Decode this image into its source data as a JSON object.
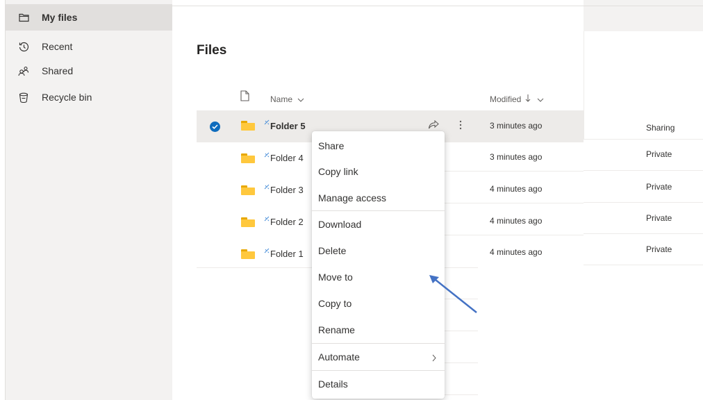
{
  "sidebar": {
    "items": [
      {
        "label": "My files",
        "icon": "folder-icon"
      },
      {
        "label": "Recent",
        "icon": "history-icon"
      },
      {
        "label": "Shared",
        "icon": "people-icon"
      },
      {
        "label": "Recycle bin",
        "icon": "trash-icon"
      }
    ]
  },
  "main": {
    "title": "Files",
    "columns": {
      "name": "Name",
      "modified": "Modified"
    },
    "rows": [
      {
        "name": "Folder 5",
        "modified": "3 minutes ago",
        "sharing": "Sharing",
        "selected": true
      },
      {
        "name": "Folder 4",
        "modified": "3 minutes ago",
        "sharing": "Private"
      },
      {
        "name": "Folder 3",
        "modified": "4 minutes ago",
        "sharing": "Private"
      },
      {
        "name": "Folder 2",
        "modified": "4 minutes ago",
        "sharing": "Private"
      },
      {
        "name": "Folder 1",
        "modified": "4 minutes ago",
        "sharing": "Private"
      }
    ]
  },
  "context_menu": {
    "items": [
      {
        "label": "Share"
      },
      {
        "label": "Copy link"
      },
      {
        "label": "Manage access"
      },
      {
        "label": "Download"
      },
      {
        "label": "Delete"
      },
      {
        "label": "Move to"
      },
      {
        "label": "Copy to"
      },
      {
        "label": "Rename"
      },
      {
        "label": "Automate",
        "has_submenu": true
      },
      {
        "label": "Details"
      }
    ]
  },
  "colors": {
    "accent": "#0f6cbd",
    "folder": "#ffc83d",
    "annotation_arrow": "#4472c4"
  }
}
